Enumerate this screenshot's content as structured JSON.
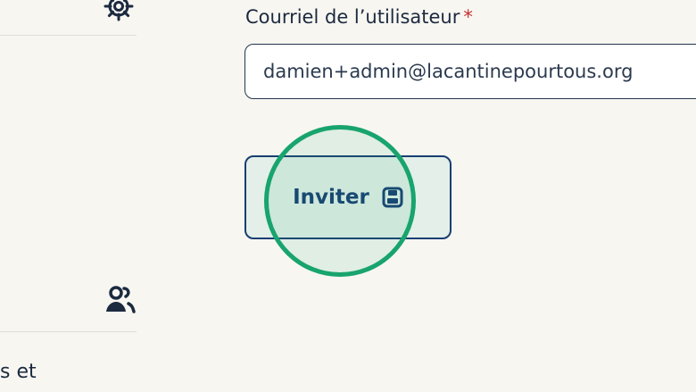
{
  "sidebar": {
    "bottom_partial_text": "s et",
    "icons": {
      "top": "gear-icon",
      "middle": "users-icon"
    }
  },
  "form": {
    "email": {
      "label": "Courriel de l’utilisateur",
      "required_marker": "*",
      "value": "damien+admin@lacantinepourtous.org"
    },
    "invite_button": {
      "label": "Inviter",
      "icon": "save-icon"
    }
  },
  "highlight": {
    "type": "click-indicator",
    "color": "#18a46d"
  },
  "colors": {
    "background": "#f8f6f1",
    "text": "#1b2a3f",
    "accent": "#193f73",
    "required": "#c53030"
  }
}
